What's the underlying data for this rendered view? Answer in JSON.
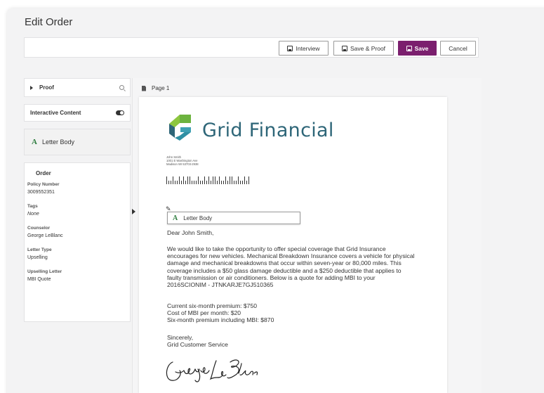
{
  "page": {
    "title": "Edit Order"
  },
  "toolbar": {
    "interview_label": "Interview",
    "save_proof_label": "Save & Proof",
    "save_label": "Save",
    "cancel_label": "Cancel"
  },
  "sidebar": {
    "proof_label": "Proof",
    "interactive_content_label": "Interactive Content",
    "letter_body_label": "Letter Body",
    "letter_body_icon": "A"
  },
  "order": {
    "heading": "Order",
    "fields": [
      {
        "label": "Policy Number",
        "value": "3009552351"
      },
      {
        "label": "Tags",
        "value": "None"
      },
      {
        "label": "Counselor",
        "value": "George LeBlanc"
      },
      {
        "label": "Letter Type",
        "value": "Upselling"
      },
      {
        "label": "Upselling Letter",
        "value": "MBI Quote"
      }
    ]
  },
  "preview": {
    "page_label": "Page 1",
    "logo_text": "Grid Financial",
    "address": [
      "John Smith",
      "1001 E Washington Ave",
      "Madison WI 53703-2938"
    ],
    "block_label": "Letter Body",
    "greeting": "Dear John Smith,",
    "body": [
      "We would like to take the opportunity to offer special coverage that Grid Insurance",
      "encourages for new vehicles.  Mechanical Breakdown Insurance covers a vehicle for physical",
      "damage and mechanical breakdowns that occur within seven-year or 80,000 miles.  This",
      "coverage includes a $50 glass damage deductible and a $250 deductible that applies to",
      "faulty transmission or air conditioners.  Below is a quote for adding MBI to your",
      "2016SCIONIM -  JTNKARJE7GJ510365"
    ],
    "quote": [
      "Current six-month premium: $750",
      "Cost of MBI per month: $20",
      "Six-month premium including MBI: $870"
    ],
    "closing": [
      "Sincerely,",
      "Grid Customer Service"
    ]
  },
  "colors": {
    "primary": "#7b1f6e",
    "logo_blue": "#2e6678",
    "logo_green": "#6cb33f"
  }
}
